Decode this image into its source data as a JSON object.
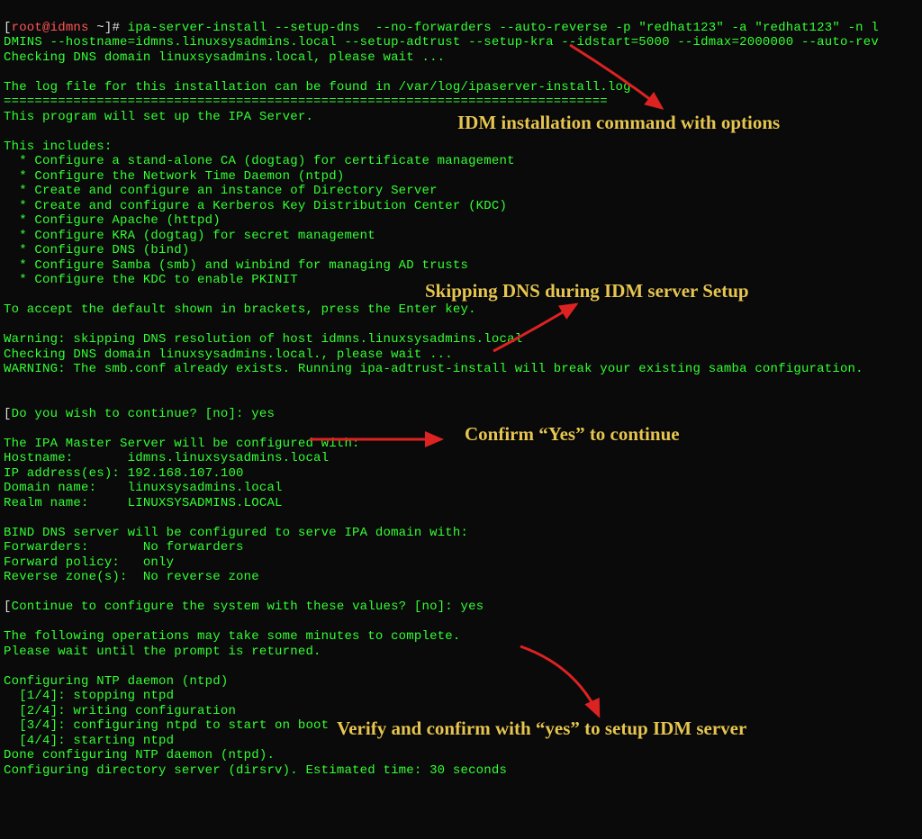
{
  "prompt": {
    "bracket_open": "[",
    "user": "root@idmns",
    "tilde": " ~",
    "bracket_close": "]",
    "hash": "# "
  },
  "command": "ipa-server-install --setup-dns  --no-forwarders --auto-reverse -p \"redhat123\" -a \"redhat123\" -n l",
  "command_line2": "DMINS --hostname=idmns.linuxsysadmins.local --setup-adtrust --setup-kra --idstart=5000 --idmax=2000000 --auto-rev",
  "l01": "Checking DNS domain linuxsysadmins.local, please wait ...",
  "l02": "",
  "l03": "The log file for this installation can be found in /var/log/ipaserver-install.log",
  "l04": "==============================================================================",
  "l05": "This program will set up the IPA Server.",
  "l06": "",
  "l07": "This includes:",
  "l08": "  * Configure a stand-alone CA (dogtag) for certificate management",
  "l09": "  * Configure the Network Time Daemon (ntpd)",
  "l10": "  * Create and configure an instance of Directory Server",
  "l11": "  * Create and configure a Kerberos Key Distribution Center (KDC)",
  "l12": "  * Configure Apache (httpd)",
  "l13": "  * Configure KRA (dogtag) for secret management",
  "l14": "  * Configure DNS (bind)",
  "l15": "  * Configure Samba (smb) and winbind for managing AD trusts",
  "l16": "  * Configure the KDC to enable PKINIT",
  "l17": "",
  "l18": "To accept the default shown in brackets, press the Enter key.",
  "l19": "",
  "l20": "Warning: skipping DNS resolution of host idmns.linuxsysadmins.local",
  "l21": "Checking DNS domain linuxsysadmins.local., please wait ...",
  "l22": "WARNING: The smb.conf already exists. Running ipa-adtrust-install will break your existing samba configuration.",
  "l23": "",
  "l24": "",
  "l25_bracket": "[",
  "l25": "Do you wish to continue? [no]: yes",
  "l26": "",
  "l27": "The IPA Master Server will be configured with:",
  "l28": "Hostname:       idmns.linuxsysadmins.local",
  "l29": "IP address(es): 192.168.107.100",
  "l30": "Domain name:    linuxsysadmins.local",
  "l31": "Realm name:     LINUXSYSADMINS.LOCAL",
  "l32": "",
  "l33": "BIND DNS server will be configured to serve IPA domain with:",
  "l34": "Forwarders:       No forwarders",
  "l35": "Forward policy:   only",
  "l36": "Reverse zone(s):  No reverse zone",
  "l37": "",
  "l38_bracket": "[",
  "l38": "Continue to configure the system with these values? [no]: yes",
  "l39": "",
  "l40": "The following operations may take some minutes to complete.",
  "l41": "Please wait until the prompt is returned.",
  "l42": "",
  "l43": "Configuring NTP daemon (ntpd)",
  "l44": "  [1/4]: stopping ntpd",
  "l45": "  [2/4]: writing configuration",
  "l46": "  [3/4]: configuring ntpd to start on boot",
  "l47": "  [4/4]: starting ntpd",
  "l48": "Done configuring NTP daemon (ntpd).",
  "l49": "Configuring directory server (dirsrv). Estimated time: 30 seconds",
  "annotations": {
    "a1": "IDM installation command with options",
    "a2": "Skipping DNS during IDM server Setup",
    "a3": "Confirm “Yes” to continue",
    "a4": "Verify and confirm with “yes” to setup IDM server"
  },
  "colors": {
    "terminal_fg": "#33ff33",
    "annotation_fg": "#e6c550",
    "arrow_red": "#dd2222"
  }
}
